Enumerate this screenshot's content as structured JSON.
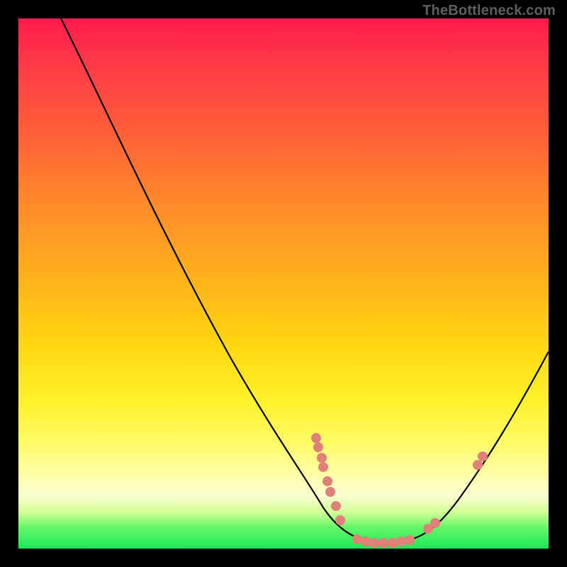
{
  "watermark": "TheBottleneck.com",
  "chart_data": {
    "type": "line",
    "title": "",
    "xlabel": "",
    "ylabel": "",
    "xlim": [
      0,
      1
    ],
    "ylim": [
      0,
      1
    ],
    "note": "Axes are unlabeled in the source image; values are normalized 0–1 estimates. Background is a vertical heat gradient (red→green). Curve enters at top-left, reaches a minimum near x≈0.70, then rises to the right edge near mid-height. Dots are sample points clustered near the valley.",
    "series": [
      {
        "name": "curve",
        "style": "black-line",
        "x": [
          0.08,
          0.16,
          0.27,
          0.4,
          0.48,
          0.55,
          0.58,
          0.63,
          0.7,
          0.76,
          0.79,
          0.83,
          0.88,
          0.94,
          1.0
        ],
        "y": [
          1.0,
          0.84,
          0.6,
          0.36,
          0.22,
          0.14,
          0.08,
          0.04,
          0.01,
          0.01,
          0.04,
          0.09,
          0.16,
          0.25,
          0.37
        ]
      },
      {
        "name": "dots",
        "style": "salmon-points",
        "x": [
          0.562,
          0.566,
          0.572,
          0.575,
          0.583,
          0.588,
          0.599,
          0.607,
          0.639,
          0.655,
          0.671,
          0.689,
          0.706,
          0.722,
          0.738,
          0.773,
          0.786,
          0.866,
          0.876
        ],
        "y": [
          0.208,
          0.191,
          0.171,
          0.154,
          0.127,
          0.107,
          0.08,
          0.053,
          0.017,
          0.013,
          0.011,
          0.011,
          0.011,
          0.013,
          0.016,
          0.037,
          0.048,
          0.158,
          0.174
        ]
      }
    ],
    "background_gradient_stops": [
      {
        "pos": 0.0,
        "color": "#ff1a4d"
      },
      {
        "pos": 0.08,
        "color": "#ff3848"
      },
      {
        "pos": 0.2,
        "color": "#ff5a3a"
      },
      {
        "pos": 0.35,
        "color": "#ff8a2a"
      },
      {
        "pos": 0.5,
        "color": "#ffb41a"
      },
      {
        "pos": 0.62,
        "color": "#ffd80f"
      },
      {
        "pos": 0.72,
        "color": "#fff22a"
      },
      {
        "pos": 0.8,
        "color": "#fffb66"
      },
      {
        "pos": 0.86,
        "color": "#ffffa8"
      },
      {
        "pos": 0.9,
        "color": "#fbffd0"
      },
      {
        "pos": 0.93,
        "color": "#d6ff9a"
      },
      {
        "pos": 0.96,
        "color": "#68f768"
      },
      {
        "pos": 1.0,
        "color": "#18e858"
      }
    ]
  }
}
